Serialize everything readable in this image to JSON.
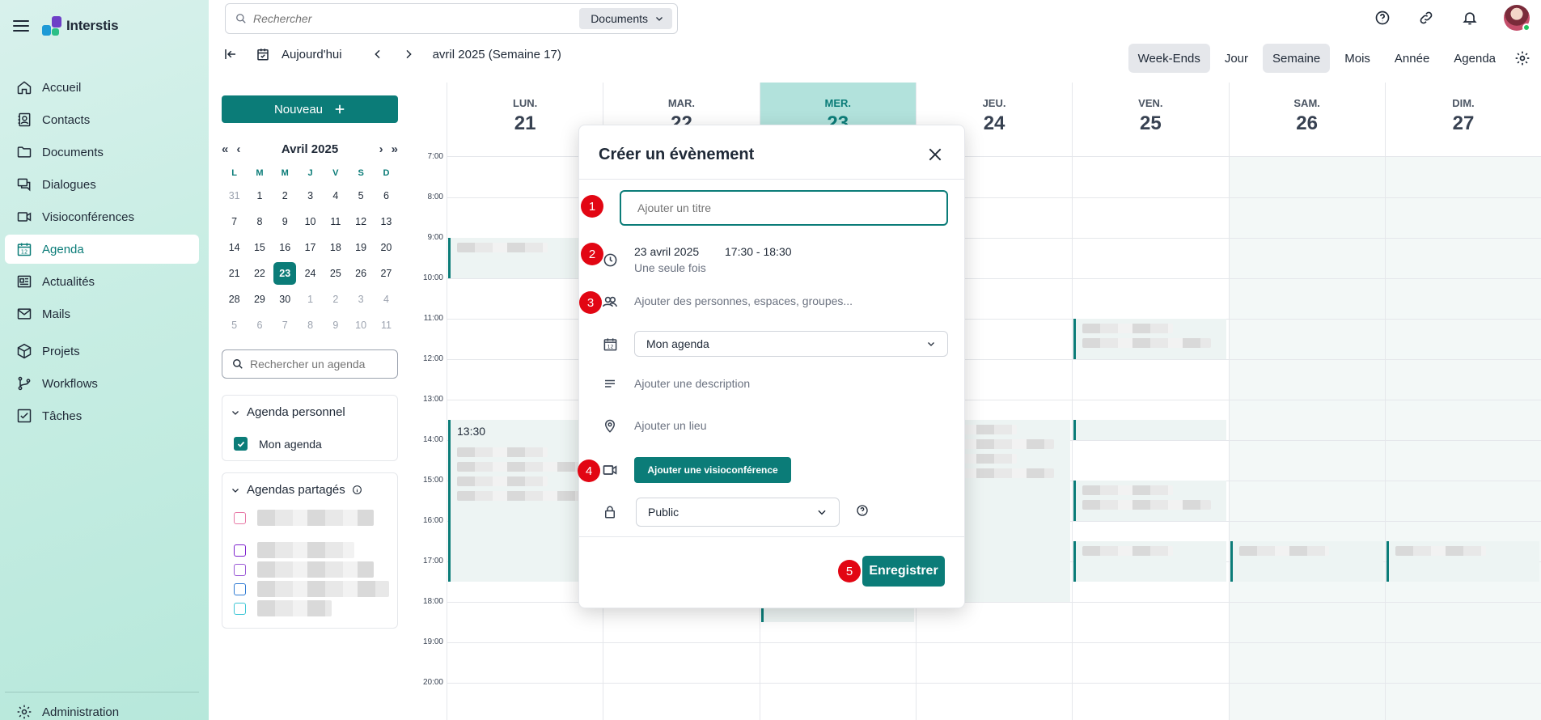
{
  "app": {
    "name": "Interstis"
  },
  "colors": {
    "accent": "#0b7c78",
    "today_header": "#b2e2dc",
    "annotation_badge": "#e20613"
  },
  "nav": {
    "items": [
      {
        "label": "Accueil",
        "icon": "home-icon"
      },
      {
        "label": "Contacts",
        "icon": "contacts-icon"
      },
      {
        "label": "Documents",
        "icon": "folder-icon"
      },
      {
        "label": "Dialogues",
        "icon": "chat-icon"
      },
      {
        "label": "Visioconférences",
        "icon": "video-icon"
      },
      {
        "label": "Agenda",
        "icon": "calendar-icon",
        "active": true
      },
      {
        "label": "Actualités",
        "icon": "news-icon"
      },
      {
        "label": "Mails",
        "icon": "mail-icon"
      },
      {
        "label": "Projets",
        "icon": "cube-icon"
      },
      {
        "label": "Workflows",
        "icon": "workflow-icon"
      },
      {
        "label": "Tâches",
        "icon": "task-icon"
      }
    ],
    "admin": "Administration"
  },
  "top": {
    "search_placeholder": "Rechercher",
    "scope": "Documents"
  },
  "toolbar": {
    "today": "Aujourd'hui",
    "period": "avril 2025 (Semaine 17)",
    "views": [
      "Week-Ends",
      "Jour",
      "Semaine",
      "Mois",
      "Année",
      "Agenda"
    ]
  },
  "sidebar": {
    "new_button": "Nouveau",
    "mini_month": "Avril 2025",
    "weekdays": [
      "L",
      "M",
      "M",
      "J",
      "V",
      "S",
      "D"
    ],
    "weeks": [
      [
        "31",
        "1",
        "2",
        "3",
        "4",
        "5",
        "6"
      ],
      [
        "7",
        "8",
        "9",
        "10",
        "11",
        "12",
        "13"
      ],
      [
        "14",
        "15",
        "16",
        "17",
        "18",
        "19",
        "20"
      ],
      [
        "21",
        "22",
        "23",
        "24",
        "25",
        "26",
        "27"
      ],
      [
        "28",
        "29",
        "30",
        "1",
        "2",
        "3",
        "4"
      ],
      [
        "5",
        "6",
        "7",
        "8",
        "9",
        "10",
        "11"
      ]
    ],
    "today": "23",
    "agenda_search_placeholder": "Rechercher un agenda",
    "personal_title": "Agenda personnel",
    "personal_calendar": "Mon agenda",
    "shared_title": "Agendas partagés",
    "shared_colors": [
      "#e879a6",
      "#7e22ce",
      "#9b59d6",
      "#2f7bd4",
      "#3ec6d6"
    ]
  },
  "calendar": {
    "days": [
      {
        "name": "LUN.",
        "date": "21"
      },
      {
        "name": "MAR.",
        "date": "22"
      },
      {
        "name": "MER.",
        "date": "23",
        "today": true
      },
      {
        "name": "JEU.",
        "date": "24"
      },
      {
        "name": "VEN.",
        "date": "25"
      },
      {
        "name": "SAM.",
        "date": "26"
      },
      {
        "name": "DIM.",
        "date": "27"
      }
    ],
    "hours": [
      "7:00",
      "8:00",
      "9:00",
      "10:00",
      "11:00",
      "12:00",
      "13:00",
      "14:00",
      "15:00",
      "16:00",
      "17:00",
      "18:00",
      "19:00",
      "20:00"
    ],
    "event_time": "13:30"
  },
  "modal": {
    "title": "Créer un évènement",
    "title_placeholder": "Ajouter un titre",
    "date": "23 avril 2025",
    "time": "17:30 - 18:30",
    "recurrence": "Une seule fois",
    "people_placeholder": "Ajouter des personnes, espaces, groupes...",
    "calendar": "Mon agenda",
    "description_placeholder": "Ajouter une description",
    "location_placeholder": "Ajouter un lieu",
    "visio_button": "Ajouter une visioconférence",
    "visibility": "Public",
    "save": "Enregistrer",
    "badges": [
      "1",
      "2",
      "3",
      "4",
      "5"
    ]
  }
}
